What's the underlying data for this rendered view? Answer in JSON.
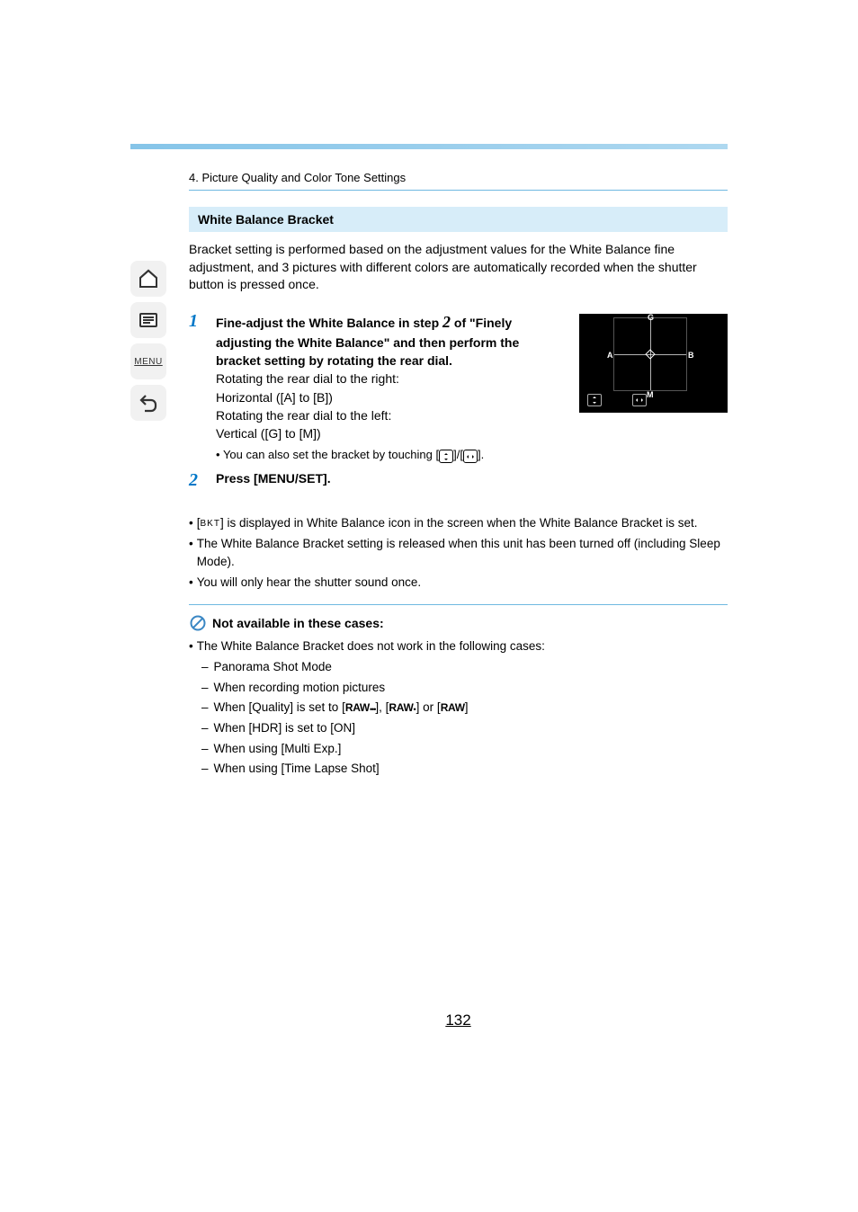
{
  "breadcrumb": "4. Picture Quality and Color Tone Settings",
  "section_title": "White Balance Bracket",
  "intro": "Bracket setting is performed based on the adjustment values for the White Balance fine adjustment, and 3 pictures with different colors are automatically recorded when the shutter button is pressed once.",
  "sidenav": {
    "menu": "MENU"
  },
  "steps": {
    "s1": {
      "num": "1",
      "head_a": "Fine-adjust the White Balance in step ",
      "head_step_ref": "2",
      "head_b": " of \"Finely adjusting the White Balance\" and then perform the bracket setting by rotating the rear dial.",
      "line1": "Rotating the rear dial to the right:",
      "line2": "Horizontal ([A] to [B])",
      "line3": "Rotating the rear dial to the left:",
      "line4": "Vertical ([G] to [M])",
      "note_a": "You can also set the bracket by touching [",
      "note_b": "]/[",
      "note_c": "]."
    },
    "s2": {
      "num": "2",
      "head": "Press [MENU/SET]."
    }
  },
  "diagram": {
    "G": "G",
    "A": "A",
    "B": "B",
    "M": "M"
  },
  "notes": {
    "n1a": "[",
    "n1_bkt": "BKT",
    "n1b": "] is displayed in White Balance icon in the screen when the White Balance Bracket is set.",
    "n2": "The White Balance Bracket setting is released when this unit has been turned off (including Sleep Mode).",
    "n3": "You will only hear the shutter sound once."
  },
  "na": {
    "title": "Not available in these cases:",
    "lead": "The White Balance Bracket does not work in the following cases:",
    "items": {
      "i1": "Panorama Shot Mode",
      "i2": "When recording motion pictures",
      "i3a": "When [Quality] is set to [",
      "i3_r1": "RAW",
      "i3_r1_s": "•••",
      "i3b": "], [",
      "i3_r2": "RAW",
      "i3_r2_s": "•",
      "i3c": "] or [",
      "i3_r3": "RAW",
      "i3d": "]",
      "i4": "When [HDR] is set to [ON]",
      "i5": "When using [Multi Exp.]",
      "i6": "When using [Time Lapse Shot]"
    }
  },
  "page_number": "132"
}
